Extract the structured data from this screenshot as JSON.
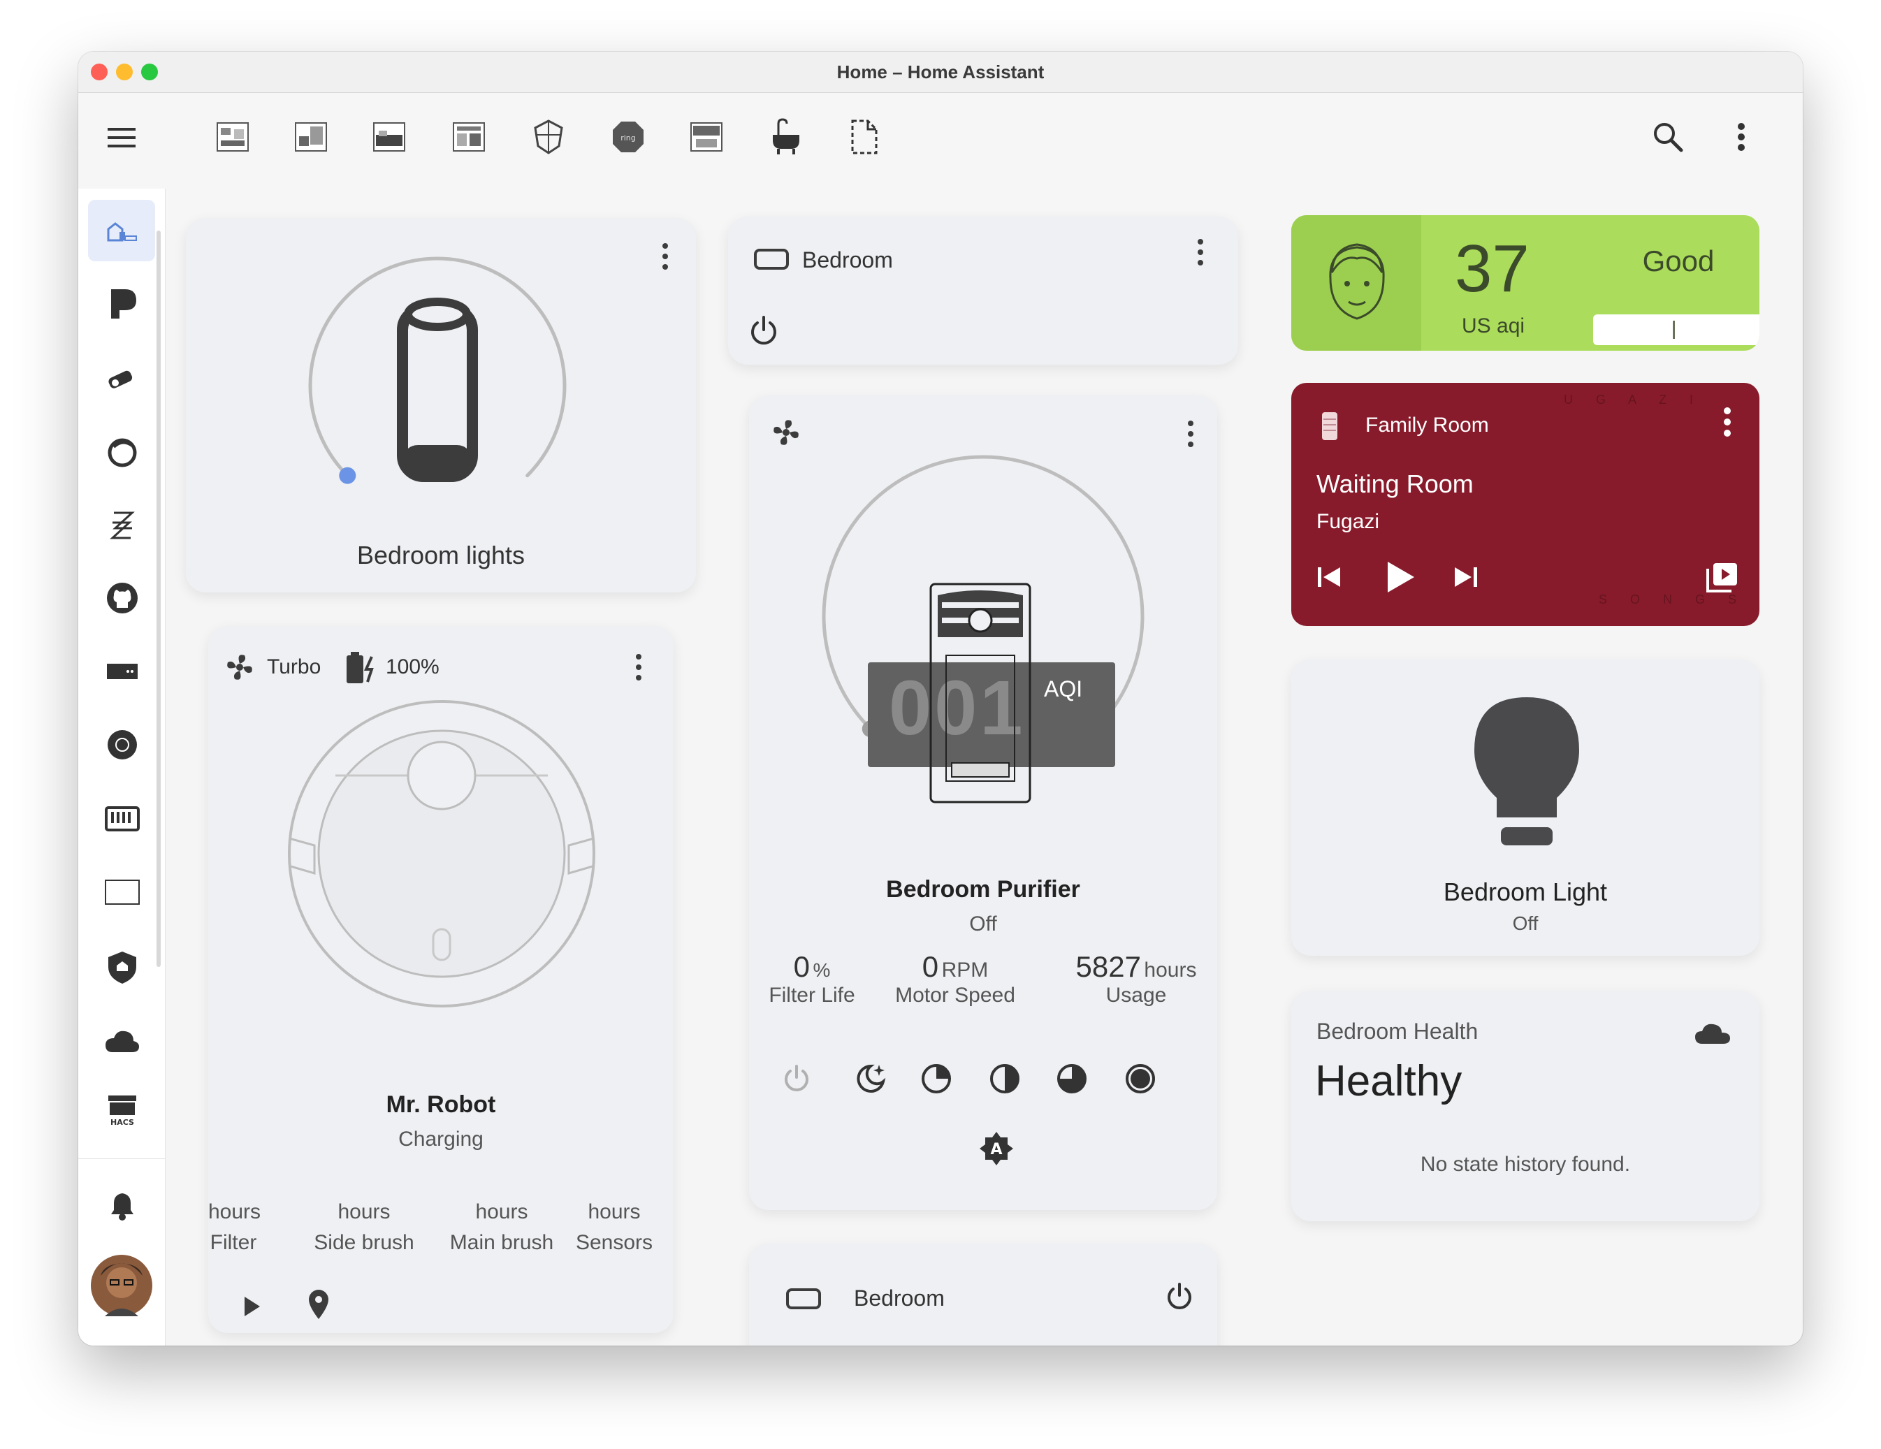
{
  "window": {
    "title": "Home – Home Assistant"
  },
  "toolbar": {
    "tabs": [
      {
        "icon": "room-1-icon"
      },
      {
        "icon": "room-2-icon"
      },
      {
        "icon": "bedroom-icon"
      },
      {
        "icon": "room-4-icon"
      },
      {
        "icon": "shield-house-icon"
      },
      {
        "icon": "ring-icon"
      },
      {
        "icon": "room-7-icon"
      },
      {
        "icon": "bathtub-icon"
      },
      {
        "icon": "document-icon"
      }
    ],
    "active_tab_index": 2
  },
  "sidebar": {
    "items": [
      {
        "icon": "home-overview-icon"
      },
      {
        "icon": "plex-icon"
      },
      {
        "icon": "camera-icon"
      },
      {
        "icon": "reptile-icon"
      },
      {
        "icon": "zigbee-icon"
      },
      {
        "icon": "github-icon"
      },
      {
        "icon": "router-icon"
      },
      {
        "icon": "speaker-icon"
      },
      {
        "icon": "keyboard-icon"
      },
      {
        "icon": "tv-outline-icon"
      },
      {
        "icon": "home-shield-icon"
      },
      {
        "icon": "cloud-icon"
      },
      {
        "icon": "hacs-store-icon"
      }
    ],
    "hacs_text": "HACS",
    "bottom": [
      {
        "icon": "bell-icon"
      },
      {
        "icon": "avatar"
      }
    ]
  },
  "lights_card": {
    "name": "Bedroom lights",
    "brightness_fraction": 0.0
  },
  "tv_card": {
    "name": "Bedroom"
  },
  "vacuum_card": {
    "fan_mode": "Turbo",
    "battery": "100%",
    "name": "Mr. Robot",
    "status": "Charging",
    "stats": [
      {
        "unit": "hours",
        "label": "Filter"
      },
      {
        "unit": "hours",
        "label": "Side brush"
      },
      {
        "unit": "hours",
        "label": "Main brush"
      },
      {
        "unit": "hours",
        "label": "Sensors"
      }
    ]
  },
  "purifier_card": {
    "aqi_value": "001",
    "aqi_unit": "AQI",
    "name": "Bedroom Purifier",
    "state": "Off",
    "level_fraction": 0.0,
    "stats": [
      {
        "value": "0",
        "unit": "%",
        "label": "Filter Life"
      },
      {
        "value": "0",
        "unit": "RPM",
        "label": "Motor Speed"
      },
      {
        "value": "5827",
        "unit": "hours",
        "label": "Usage"
      }
    ],
    "auto_badge": "A"
  },
  "media_small_card": {
    "name": "Bedroom"
  },
  "aqi_card": {
    "value": "37",
    "unit": "US aqi",
    "label": "Good",
    "bar_marker": "|",
    "bg_color": "#abdc5b",
    "face_bg": "#9ccf4f"
  },
  "media_card": {
    "room": "Family Room",
    "title": "Waiting Room",
    "artist": "Fugazi",
    "bg_color": "#881b2b",
    "art_text_top": "U G A Z I",
    "art_text_bottom": "S O N G S"
  },
  "light_card": {
    "name": "Bedroom Light",
    "state": "Off"
  },
  "health_card": {
    "title": "Bedroom Health",
    "state": "Healthy",
    "message": "No state history found."
  },
  "colors": {
    "accent_blue": "#6b93e6",
    "card_bg": "#eef0f3",
    "icon_dark": "#3c3c3c"
  }
}
